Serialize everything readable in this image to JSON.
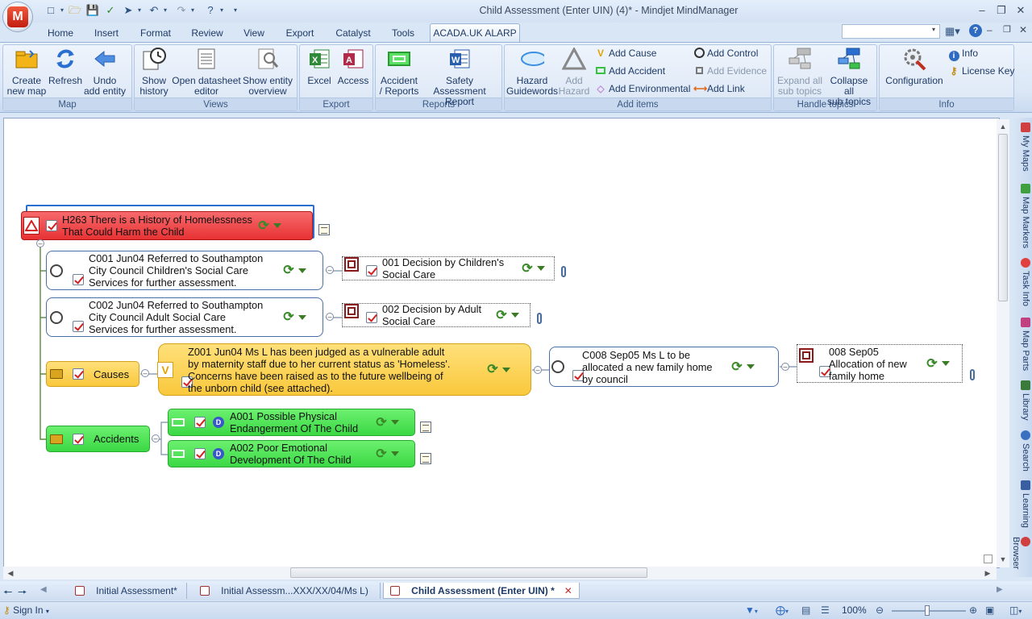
{
  "window": {
    "title": "Child Assessment (Enter UIN)  (4)* - Mindjet MindManager",
    "app_logo_letter": "M"
  },
  "tabs": [
    "Home",
    "Insert",
    "Format",
    "Review",
    "View",
    "Export",
    "Catalyst",
    "Tools",
    "ACADA.UK ALARP"
  ],
  "active_tab": "ACADA.UK ALARP",
  "ribbon": {
    "groups": {
      "map": "Map",
      "views": "Views",
      "export": "Export",
      "reports": "Reports",
      "add_items": "Add items",
      "handle_topics": "Handle topics",
      "info": "Info"
    },
    "buttons": {
      "create_new_map": "Create\nnew map",
      "refresh": "Refresh",
      "undo_add_entity": "Undo\nadd entity",
      "show_history": "Show\nhistory",
      "open_datasheet_editor": "Open datasheet\neditor",
      "show_entity_overview": "Show entity\noverview",
      "excel": "Excel",
      "access": "Access",
      "accident_reports": "Accident\n/ Reports",
      "safety_assessment_report": "Safety Assessment\nReport",
      "hazard_guidewords": "Hazard\nGuidewords",
      "add_hazard": "Add\nHazard",
      "add_cause": "Add Cause",
      "add_accident": "Add Accident",
      "add_environmental": "Add Environmental",
      "add_control": "Add Control",
      "add_evidence": "Add Evidence",
      "add_link": "Add Link",
      "expand_all": "Expand all\nsub topics",
      "collapse_all": "Collapse all\nsub topics",
      "configuration": "Configuration",
      "info": "Info",
      "license_key": "License Key"
    }
  },
  "map": {
    "hazard": "H263 There is a History of Homelessness\nThat Could Harm the Child",
    "control_c001": "C001 Jun04 Referred to Southampton\nCity Council Children's Social Care\nServices for further assessment.",
    "evidence_001": "001 Decision by Children's\nSocial Care",
    "control_c002": "C002 Jun04 Referred to Southampton\nCity Council Adult Social Care\nServices for further assessment.",
    "evidence_002": "002 Decision by Adult\nSocial Care",
    "causes_label": "Causes",
    "cause_z001": "Z001 Jun04 Ms L has been judged as a vulnerable adult\nby maternity staff due to her current status as 'Homeless'.\nConcerns have been raised as to the future wellbeing of\nthe unborn child (see attached).",
    "control_c008": "C008 Sep05 Ms L to be\nallocated a new family home\nby council",
    "evidence_008": "008 Sep05\nAllocation of new\nfamily home",
    "accidents_label": "Accidents",
    "accident_a001": "A001 Possible Physical\nEndangerment Of The Child",
    "accident_a002": "A002 Poor Emotional\nDevelopment Of The Child"
  },
  "side_panel": [
    "My Maps",
    "Map Markers",
    "Task Info",
    "Map Parts",
    "Library",
    "Search",
    "Learning",
    "Browser"
  ],
  "doc_tabs": [
    {
      "label": "Initial Assessment*",
      "active": false
    },
    {
      "label": "Initial Assessm...XXX/XX/04/Ms L)",
      "active": false
    },
    {
      "label": "Child Assessment (Enter UIN) *",
      "active": true
    }
  ],
  "status": {
    "sign_in": "Sign In",
    "zoom": "100%",
    "zoom_level": 1.0
  },
  "colors": {
    "hazard_fill": "#f0474a",
    "cause_fill": "#fdd25a",
    "accident_fill": "#4fe05a",
    "active_tab_text": "#1e3a66"
  }
}
